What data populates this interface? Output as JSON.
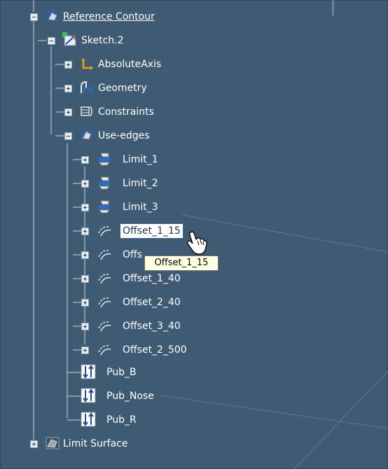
{
  "tree": {
    "reference_contour": "Reference Contour",
    "sketch": "Sketch.2",
    "absolute_axis": "AbsoluteAxis",
    "geometry": "Geometry",
    "constraints": "Constraints",
    "use_edges": "Use-edges",
    "limits": [
      "Limit_1",
      "Limit_2",
      "Limit_3"
    ],
    "offset_selected": "Offset_1_15",
    "offset_partial": "Offs",
    "offsets": [
      "Offset_1_40",
      "Offset_2_40",
      "Offset_3_40",
      "Offset_2_500"
    ],
    "pubs": [
      "Pub_B",
      "Pub_Nose",
      "Pub_R"
    ],
    "limit_surface": "Limit Surface"
  },
  "tooltip": {
    "text": "Offset_1_15"
  },
  "colors": {
    "background": "#3f5b73",
    "selection": "#ffffff",
    "tooltip_bg": "#ffffe1",
    "sketch_badge": "#2ecc40"
  },
  "icons": {
    "part_body": "part-body-icon",
    "sketch": "sketch-icon",
    "axis": "axis-icon",
    "geometry": "geometry-icon",
    "constraint": "constraint-icon",
    "limit": "limit-icon",
    "offset": "offset-curve-icon",
    "publication": "publication-icon",
    "surface": "surface-icon",
    "hand_cursor": "hand-cursor-icon"
  }
}
